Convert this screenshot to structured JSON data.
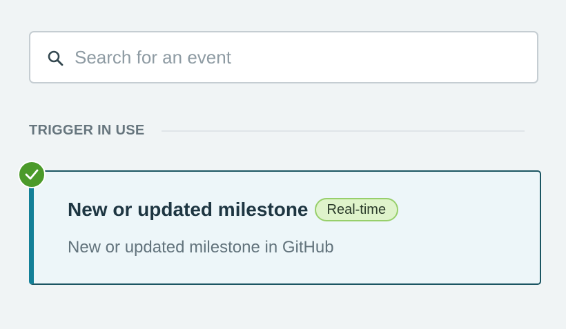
{
  "search": {
    "placeholder": "Search for an event",
    "value": "",
    "icon": "search-icon"
  },
  "section": {
    "title": "TRIGGER IN USE"
  },
  "trigger_card": {
    "title": "New or updated milestone",
    "badge": "Real-time",
    "description": "New or updated milestone in GitHub",
    "selected": true,
    "status_icon": "check-circle-icon"
  },
  "colors": {
    "background": "#f0f4f5",
    "card_accent": "#138098",
    "card_border": "#1b5562",
    "card_background": "#edf6f9",
    "badge_background": "#dff3cb",
    "badge_border": "#97cf6b",
    "check_green": "#4b9a2a"
  }
}
